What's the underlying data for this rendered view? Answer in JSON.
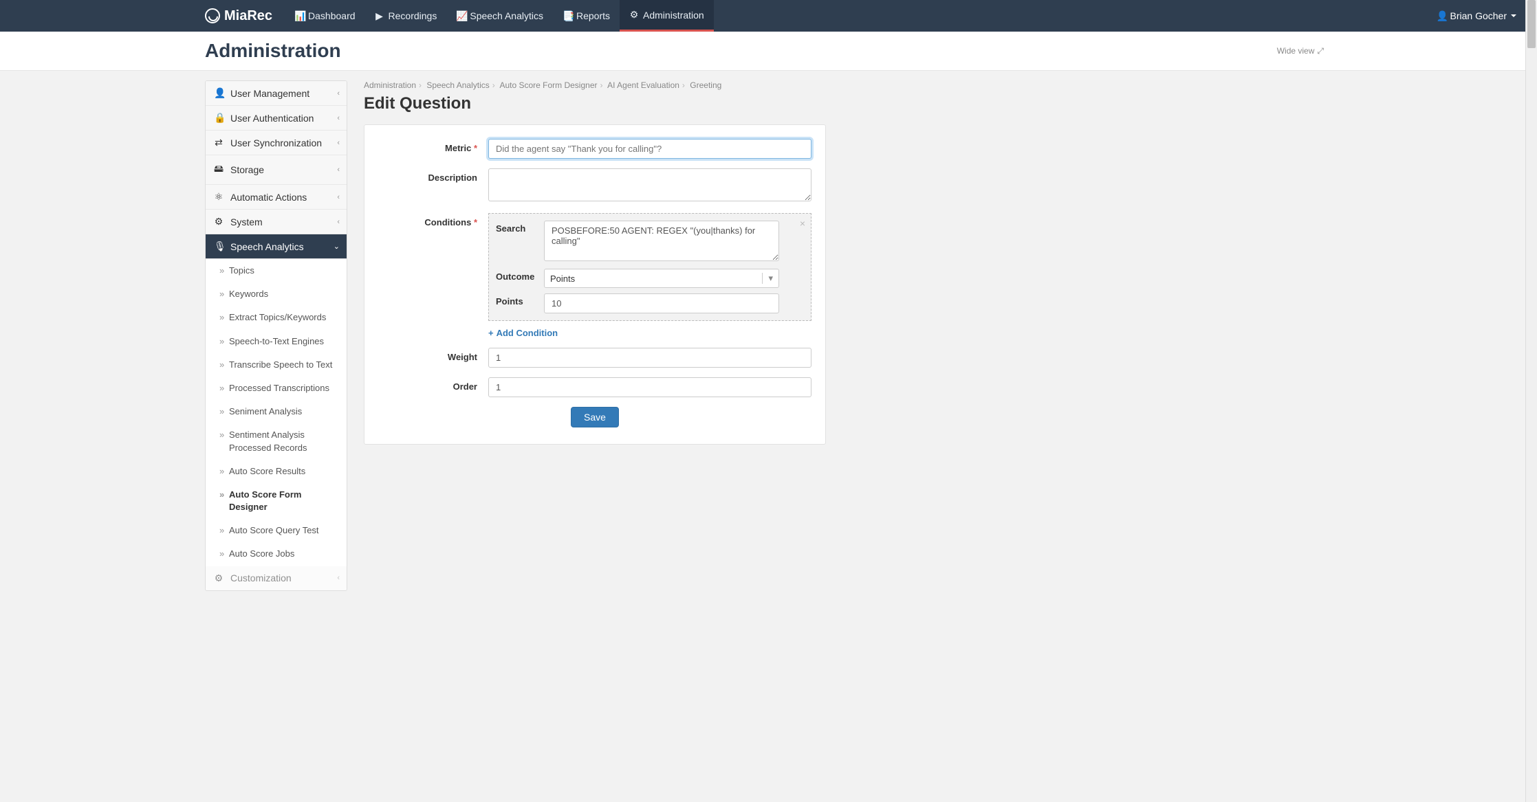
{
  "brand": "MiaRec",
  "nav": [
    {
      "icon": "📊",
      "label": "Dashboard"
    },
    {
      "icon": "▶",
      "label": "Recordings"
    },
    {
      "icon": "📈",
      "label": "Speech Analytics"
    },
    {
      "icon": "📑",
      "label": "Reports"
    },
    {
      "icon": "⚙",
      "label": "Administration"
    }
  ],
  "user": "Brian Gocher",
  "subtitle": "Administration",
  "wide_view": "Wide view",
  "sidebar": {
    "items": [
      {
        "icon": "👤",
        "label": "User Management"
      },
      {
        "icon": "🔒",
        "label": "User Authentication"
      },
      {
        "icon": "⇄",
        "label": "User Synchronization"
      },
      {
        "icon": "🖴",
        "label": "Storage"
      },
      {
        "icon": "⚛",
        "label": "Automatic Actions"
      },
      {
        "icon": "⚙",
        "label": "System"
      },
      {
        "icon": "🎙",
        "label": "Speech Analytics"
      },
      {
        "icon": "⚙",
        "label": "Customization"
      }
    ],
    "speech_sub": [
      "Topics",
      "Keywords",
      "Extract Topics/Keywords",
      "Speech-to-Text Engines",
      "Transcribe Speech to Text",
      "Processed Transcriptions",
      "Seniment Analysis",
      "Sentiment Analysis Processed Records",
      "Auto Score Results",
      "Auto Score Form Designer",
      "Auto Score Query Test",
      "Auto Score Jobs"
    ]
  },
  "breadcrumb": [
    "Administration",
    "Speech Analytics",
    "Auto Score Form Designer",
    "AI Agent Evaluation",
    "Greeting"
  ],
  "page_title": "Edit Question",
  "form": {
    "metric_label": "Metric",
    "metric_ph": "Did the agent say \"Thank you for calling\"?",
    "metric_val": "",
    "description_label": "Description",
    "description_val": "",
    "conditions_label": "Conditions",
    "cond": {
      "search_label": "Search",
      "search_val": "POSBEFORE:50 AGENT: REGEX \"(you|thanks) for calling\"",
      "outcome_label": "Outcome",
      "outcome_val": "Points",
      "points_label": "Points",
      "points_val": "10"
    },
    "add_condition": "Add Condition",
    "weight_label": "Weight",
    "weight_val": "1",
    "order_label": "Order",
    "order_val": "1",
    "save": "Save"
  }
}
